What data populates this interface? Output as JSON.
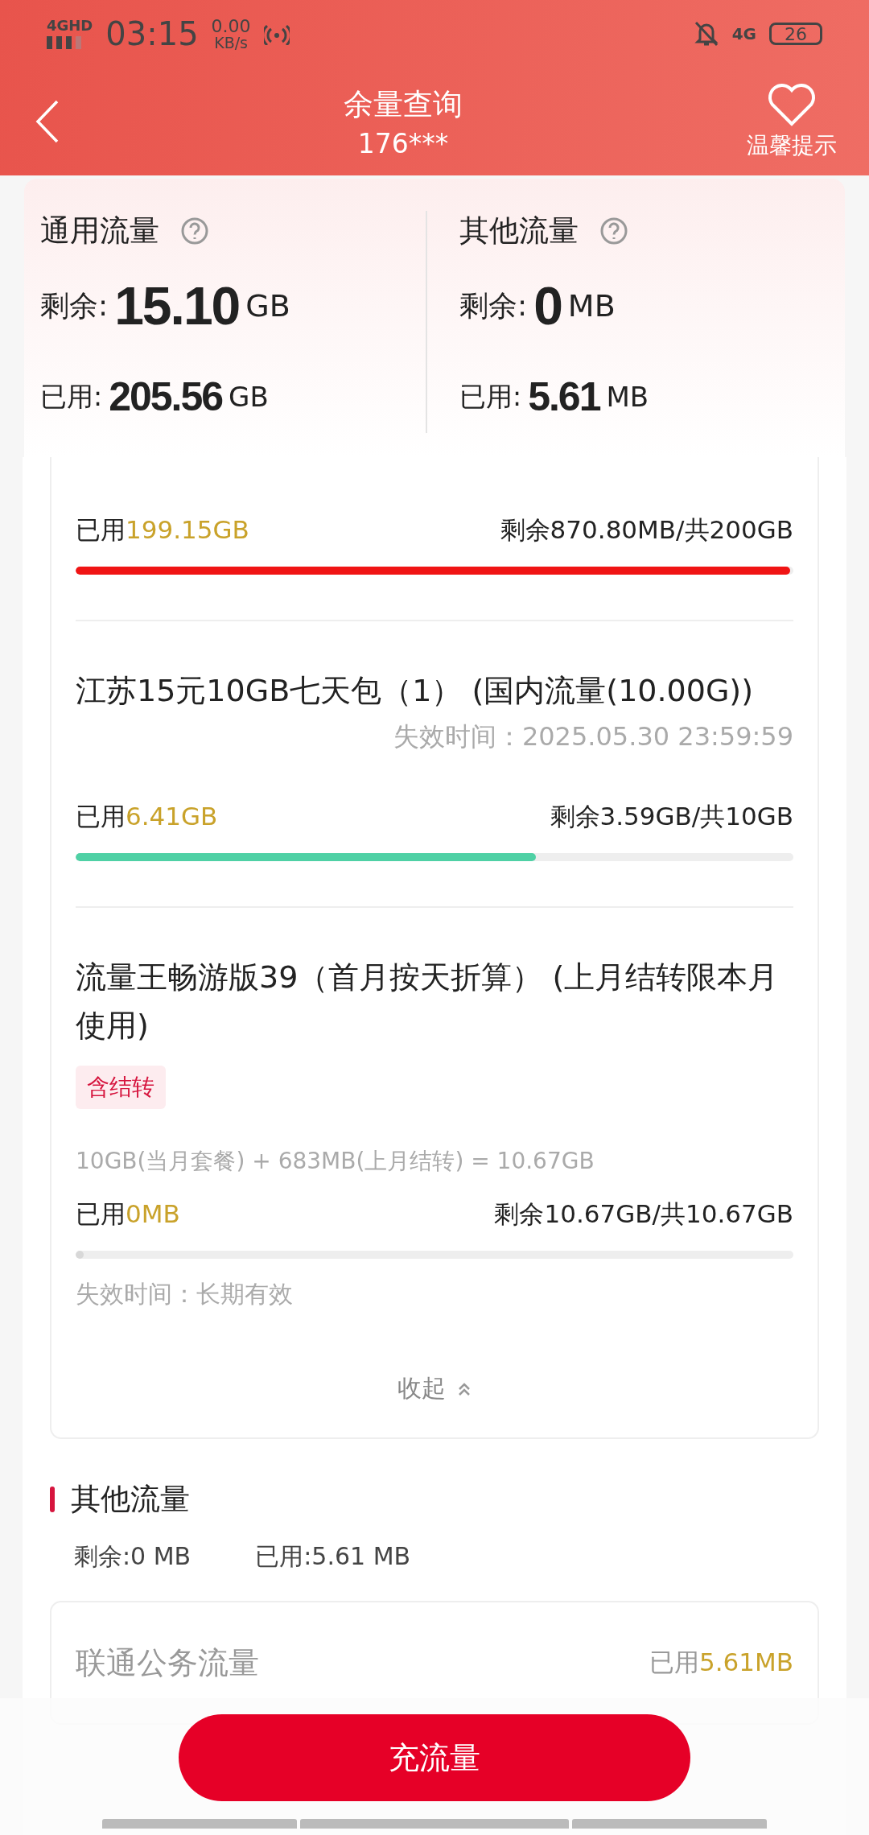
{
  "status_bar": {
    "network": "4GHD",
    "time": "03:15",
    "speed_value": "0.00",
    "speed_unit": "KB/s",
    "right_network": "4G",
    "battery": "26"
  },
  "header": {
    "title": "余量查询",
    "phone": "176***",
    "tip": "温馨提示"
  },
  "summary": [
    {
      "title": "通用流量",
      "remaining_label": "剩余:",
      "remaining_value": "15.10",
      "remaining_unit": "GB",
      "used_label": "已用:",
      "used_value": "205.56",
      "used_unit": "GB"
    },
    {
      "title": "其他流量",
      "remaining_label": "剩余:",
      "remaining_value": "0",
      "remaining_unit": "MB",
      "used_label": "已用:",
      "used_value": "5.61",
      "used_unit": "MB"
    }
  ],
  "packages": [
    {
      "used_label": "已用",
      "used_value": "199.15GB",
      "remaining": "剩余870.80MB/共200GB",
      "level": 0.996,
      "color": "#f01414"
    },
    {
      "title": "江苏15元10GB七天包（1） (国内流量(10.00G))",
      "expiry": "失效时间：2025.05.30 23:59:59",
      "used_label": "已用",
      "used_value": "6.41GB",
      "remaining": "剩余3.59GB/共10GB",
      "level": 0.641,
      "color": "#4fd1a5"
    },
    {
      "title": "流量王畅游版39（首月按天折算） (上月结转限本月使用)",
      "tag": "含结转",
      "formula": "10GB(当月套餐) + 683MB(上月结转) = 10.67GB",
      "used_label": "已用",
      "used_value": "0MB",
      "remaining": "剩余10.67GB/共10.67GB",
      "level": 0,
      "note": "失效时间：长期有效"
    }
  ],
  "collapse": "收起",
  "other": {
    "title": "其他流量",
    "remaining": "剩余:0 MB",
    "used": "已用:5.61 MB",
    "item": {
      "name": "联通公务流量",
      "used_label": "已用",
      "used_value": "5.61MB"
    }
  },
  "recharge_button": "充流量"
}
